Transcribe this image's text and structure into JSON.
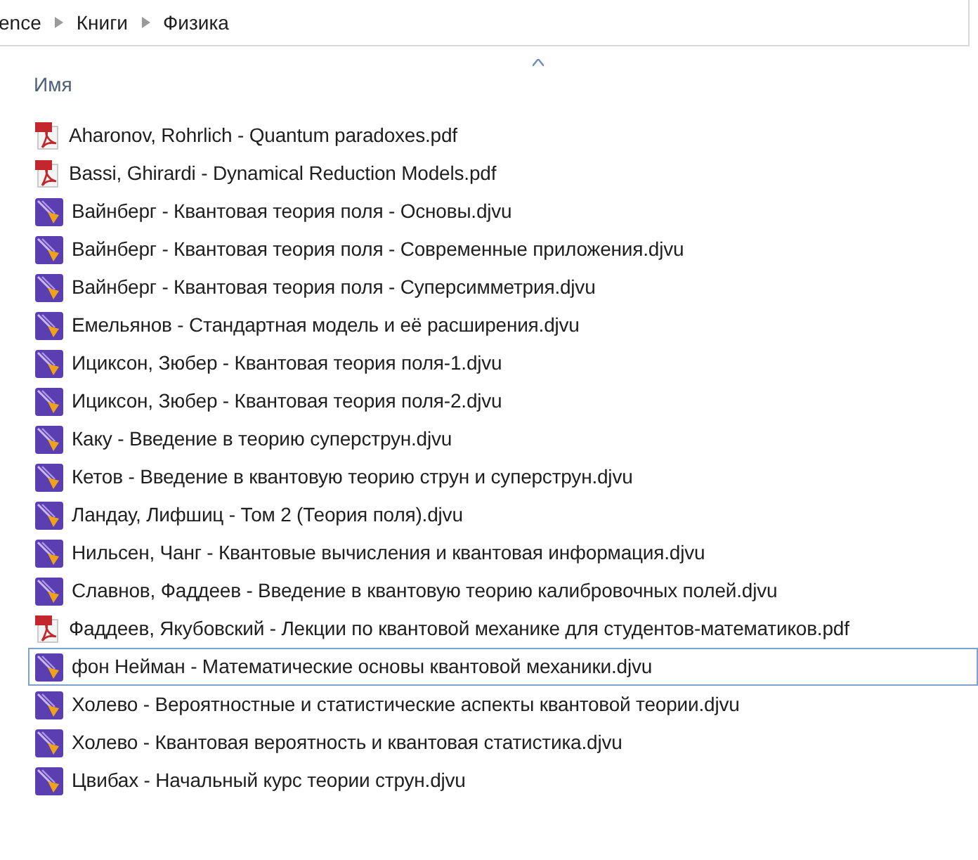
{
  "breadcrumb": [
    "ence",
    "Книги",
    "Физика"
  ],
  "column": {
    "title": "Имя"
  },
  "files": [
    {
      "name": "Aharonov, Rohrlich - Quantum paradoxes.pdf",
      "kind": "pdf",
      "selected": false
    },
    {
      "name": "Bassi, Ghirardi - Dynamical Reduction Models.pdf",
      "kind": "pdf",
      "selected": false
    },
    {
      "name": "Вайнберг - Квантовая теория поля - Основы.djvu",
      "kind": "djvu",
      "selected": false
    },
    {
      "name": "Вайнберг - Квантовая теория поля - Современные приложения.djvu",
      "kind": "djvu",
      "selected": false
    },
    {
      "name": "Вайнберг - Квантовая теория поля - Суперсимметрия.djvu",
      "kind": "djvu",
      "selected": false
    },
    {
      "name": "Емельянов - Стандартная модель и её расширения.djvu",
      "kind": "djvu",
      "selected": false
    },
    {
      "name": "Ициксон, Зюбер - Квантовая теория поля-1.djvu",
      "kind": "djvu",
      "selected": false
    },
    {
      "name": "Ициксон, Зюбер - Квантовая теория поля-2.djvu",
      "kind": "djvu",
      "selected": false
    },
    {
      "name": "Каку - Введение в теорию суперструн.djvu",
      "kind": "djvu",
      "selected": false
    },
    {
      "name": "Кетов - Введение в квантовую теорию струн и суперструн.djvu",
      "kind": "djvu",
      "selected": false
    },
    {
      "name": "Ландау, Лифшиц - Том 2 (Теория поля).djvu",
      "kind": "djvu",
      "selected": false
    },
    {
      "name": "Нильсен, Чанг - Квантовые вычисления и квантовая информация.djvu",
      "kind": "djvu",
      "selected": false
    },
    {
      "name": "Славнов, Фаддеев - Введение в квантовую теорию калибровочных полей.djvu",
      "kind": "djvu",
      "selected": false
    },
    {
      "name": "Фаддеев, Якубовский - Лекции по квантовой механике для студентов-математиков.pdf",
      "kind": "pdf",
      "selected": false
    },
    {
      "name": "фон Нейман - Математические основы квантовой механики.djvu",
      "kind": "djvu",
      "selected": true
    },
    {
      "name": "Холево - Вероятностные и статистические аспекты квантовой теории.djvu",
      "kind": "djvu",
      "selected": false
    },
    {
      "name": "Холево - Квантовая вероятность и квантовая статистика.djvu",
      "kind": "djvu",
      "selected": false
    },
    {
      "name": "Цвибах - Начальный курс теории струн.djvu",
      "kind": "djvu",
      "selected": false
    }
  ]
}
